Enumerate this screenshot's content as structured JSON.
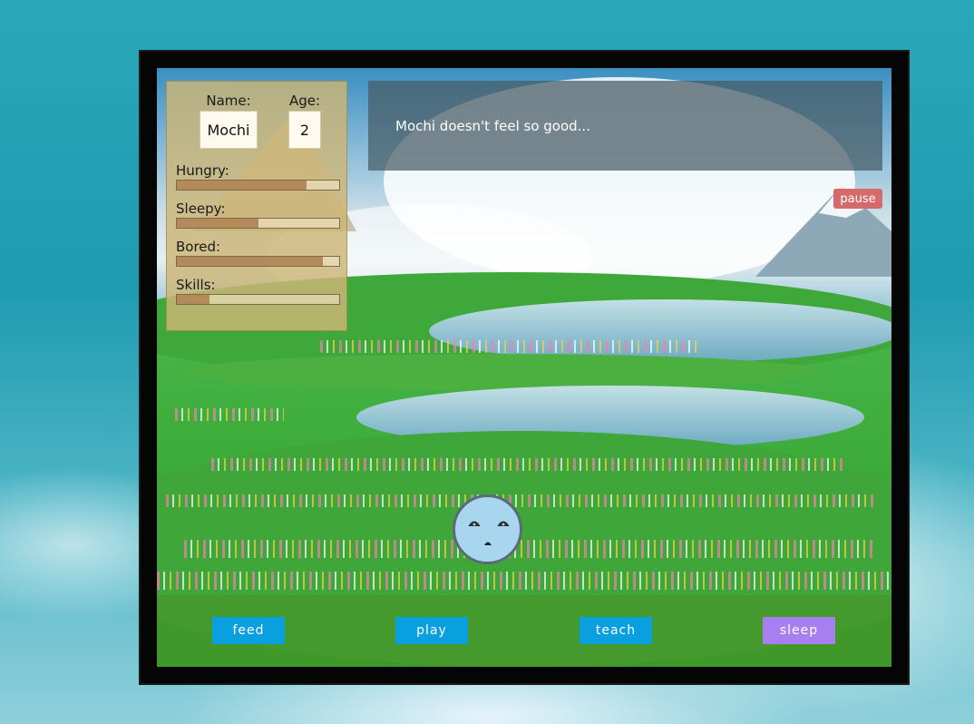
{
  "pet": {
    "name_label": "Name:",
    "name": "Mochi",
    "age_label": "Age:",
    "age": "2"
  },
  "meters": [
    {
      "label": "Hungry:",
      "level": 0.8
    },
    {
      "label": "Sleepy:",
      "level": 0.5
    },
    {
      "label": "Bored:",
      "level": 0.9
    },
    {
      "label": "Skills:",
      "level": 0.2
    }
  ],
  "message": "Mochi doesn't feel so good...",
  "controls": {
    "pause": "pause"
  },
  "actions": {
    "feed": "feed",
    "play": "play",
    "teach": "teach",
    "sleep": "sleep"
  },
  "colors": {
    "action_button": "#0aa0e0",
    "sleep_button": "#a77ff0",
    "pause_button": "#d46a6a",
    "meter_fill": "#b48a5a"
  }
}
